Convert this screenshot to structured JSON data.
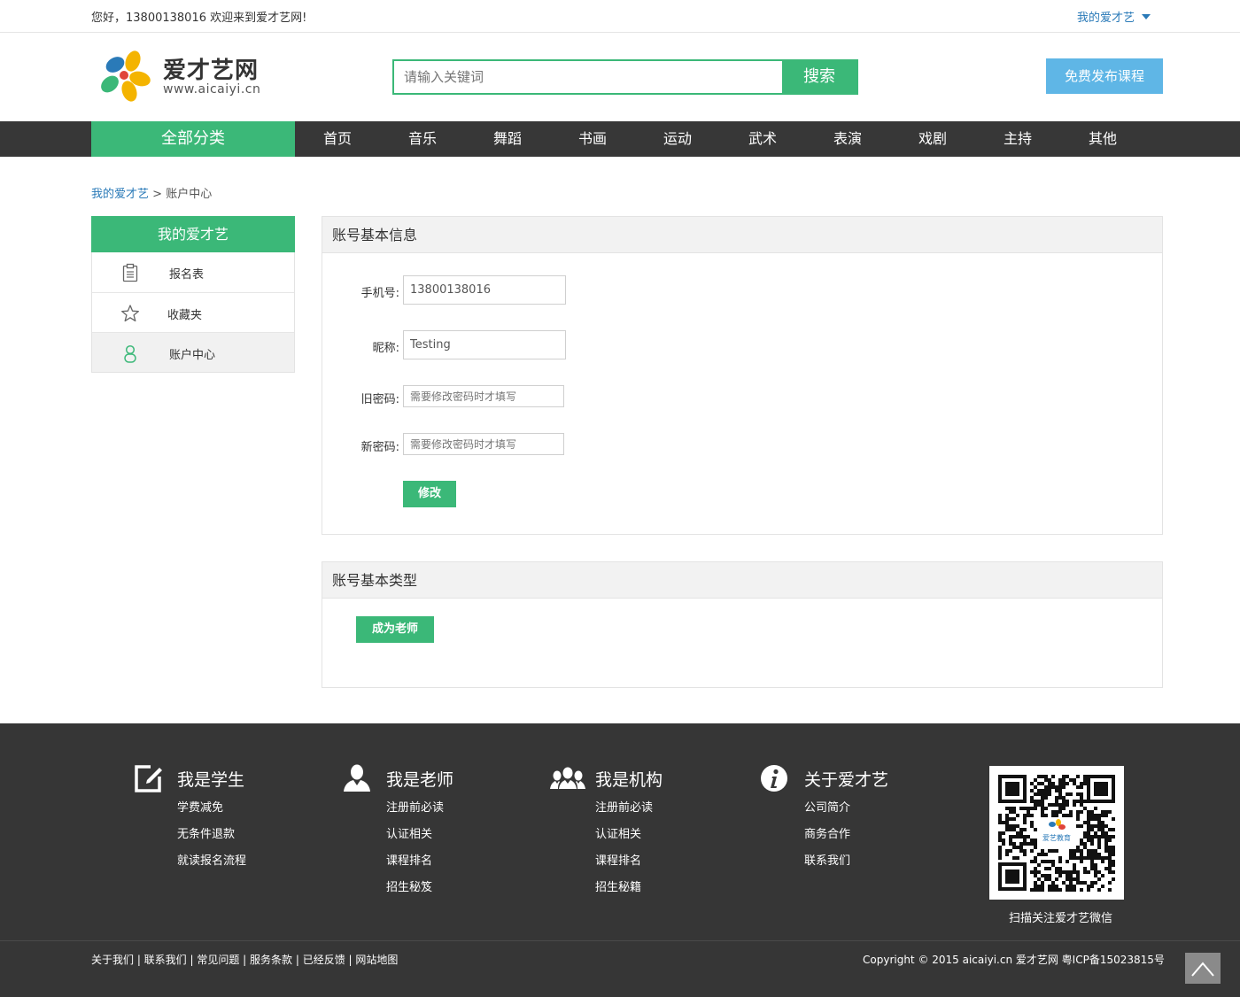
{
  "topbar": {
    "greeting": "您好，13800138016 欢迎来到爱才艺网!",
    "my_account": "我的爱才艺"
  },
  "header": {
    "logo_name": "爱才艺网",
    "logo_url": "www.aicaiyi.cn",
    "search_placeholder": "请输入关键词",
    "search_button": "搜索",
    "publish_button": "免费发布课程"
  },
  "nav": {
    "all_categories": "全部分类",
    "items": [
      "首页",
      "音乐",
      "舞蹈",
      "书画",
      "运动",
      "武术",
      "表演",
      "戏剧",
      "主持",
      "其他"
    ]
  },
  "breadcrumb": {
    "home": "我的爱才艺",
    "sep": ">",
    "current": "账户中心"
  },
  "sidebar": {
    "title": "我的爱才艺",
    "items": [
      {
        "label": "报名表",
        "icon": "clipboard-icon"
      },
      {
        "label": "收藏夹",
        "icon": "star-icon"
      },
      {
        "label": "账户中心",
        "icon": "user-icon"
      }
    ]
  },
  "account_info": {
    "title": "账号基本信息",
    "phone_label": "手机号:",
    "phone_value": "13800138016",
    "nickname_label": "昵称:",
    "nickname_value": "Testing",
    "old_pw_label": "旧密码:",
    "old_pw_placeholder": "需要修改密码时才填写",
    "new_pw_label": "新密码:",
    "new_pw_placeholder": "需要修改密码时才填写",
    "submit": "修改"
  },
  "account_type": {
    "title": "账号基本类型",
    "become_teacher": "成为老师"
  },
  "footer": {
    "columns": [
      {
        "title": "我是学生",
        "icon": "edit-icon",
        "links": [
          "学费减免",
          "无条件退款",
          "就读报名流程"
        ]
      },
      {
        "title": "我是老师",
        "icon": "person-icon",
        "links": [
          "注册前必读",
          "认证相关",
          "课程排名",
          "招生秘笈"
        ]
      },
      {
        "title": "我是机构",
        "icon": "group-icon",
        "links": [
          "注册前必读",
          "认证相关",
          "课程排名",
          "招生秘籍"
        ]
      },
      {
        "title": "关于爱才艺",
        "icon": "info-icon",
        "links": [
          "公司简介",
          "商务合作",
          "联系我们"
        ]
      }
    ],
    "qr_caption": "扫描关注爱才艺微信",
    "qr_inner_text": "爱艺教育",
    "bottom_links": "关于我们 | 联系我们 | 常见问题 | 服务条款 | 已经反馈 | 网站地图",
    "copyright": "Copyright © 2015 aicaiyi.cn 爱才艺网 粤ICP备15023815号"
  },
  "colors": {
    "green": "#3bb878",
    "blue": "#5fb6e6",
    "nav_bg": "#373737",
    "footer_bg": "#363636"
  }
}
